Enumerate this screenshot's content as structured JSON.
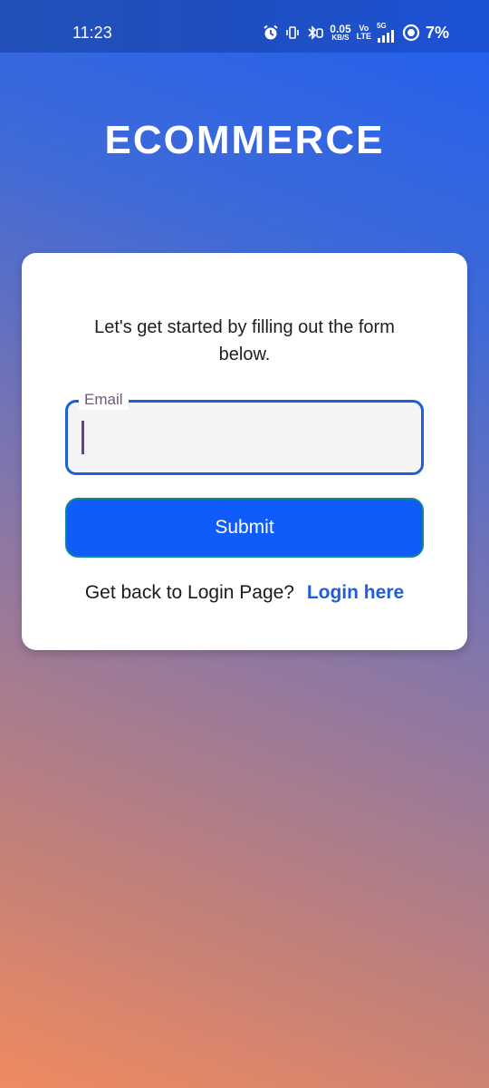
{
  "status_bar": {
    "time": "11:23",
    "net_speed_value": "0.05",
    "net_speed_unit": "KB/S",
    "volte_top": "Vo",
    "volte_bottom": "LTE",
    "network_type": "5G",
    "battery_percent": "7%",
    "icons": [
      "alarm-icon",
      "vibrate-icon",
      "bluetooth-icon",
      "signal-icon",
      "battery-icon"
    ]
  },
  "app": {
    "brand_title": "ECOMMERCE"
  },
  "form": {
    "intro_text": "Let's get started by filling out the form below.",
    "email_label": "Email",
    "email_value": "",
    "submit_label": "Submit",
    "footer_text": "Get back to Login Page?",
    "login_link_label": "Login here"
  },
  "colors": {
    "accent_blue": "#1e5ed6",
    "button_blue": "#0f5cfa",
    "gradient_top": "#1f5ff0",
    "gradient_bottom": "#ef8a60"
  }
}
